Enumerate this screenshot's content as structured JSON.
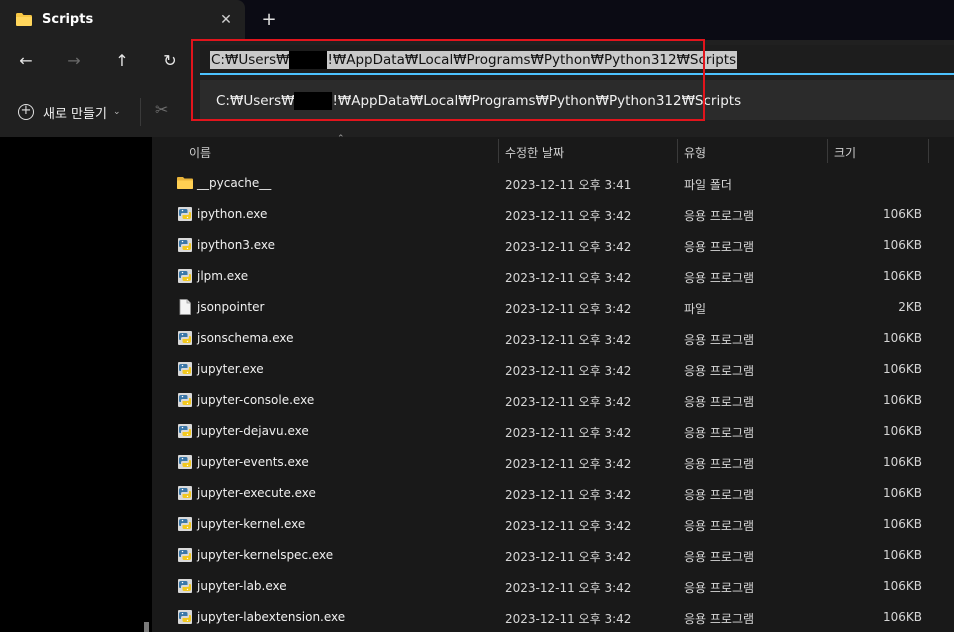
{
  "tab": {
    "title": "Scripts",
    "close_glyph": "✕",
    "new_tab_glyph": "+"
  },
  "nav": {
    "back_glyph": "←",
    "forward_glyph": "→",
    "up_glyph": "↑",
    "refresh_glyph": "↻"
  },
  "address": {
    "value_prefix": "C:₩Users₩",
    "value_suffix": "!₩AppData₩Local₩Programs₩Python₩Python312₩Scripts",
    "suggestion_prefix": "C:₩Users₩",
    "suggestion_suffix": "!₩AppData₩Local₩Programs₩Python₩Python312₩Scripts",
    "highlight_color": "#e2141c"
  },
  "command_bar": {
    "new_label": "새로 만들기",
    "new_icon": "plus-circle-icon",
    "chevron": "⌄",
    "cut_icon": "scissors-icon",
    "cut_glyph": "✂"
  },
  "columns": {
    "name": "이름",
    "date": "수정한 날짜",
    "type": "유형",
    "size": "크기",
    "sort_glyph": "⌃"
  },
  "files": [
    {
      "name": "__pycache__",
      "date": "2023-12-11 오후 3:41",
      "type": "파일 폴더",
      "size": "",
      "icon": "folder"
    },
    {
      "name": "ipython.exe",
      "date": "2023-12-11 오후 3:42",
      "type": "응용 프로그램",
      "size": "106KB",
      "icon": "python-exe"
    },
    {
      "name": "ipython3.exe",
      "date": "2023-12-11 오후 3:42",
      "type": "응용 프로그램",
      "size": "106KB",
      "icon": "python-exe"
    },
    {
      "name": "jlpm.exe",
      "date": "2023-12-11 오후 3:42",
      "type": "응용 프로그램",
      "size": "106KB",
      "icon": "python-exe"
    },
    {
      "name": "jsonpointer",
      "date": "2023-12-11 오후 3:42",
      "type": "파일",
      "size": "2KB",
      "icon": "file"
    },
    {
      "name": "jsonschema.exe",
      "date": "2023-12-11 오후 3:42",
      "type": "응용 프로그램",
      "size": "106KB",
      "icon": "python-exe"
    },
    {
      "name": "jupyter.exe",
      "date": "2023-12-11 오후 3:42",
      "type": "응용 프로그램",
      "size": "106KB",
      "icon": "python-exe"
    },
    {
      "name": "jupyter-console.exe",
      "date": "2023-12-11 오후 3:42",
      "type": "응용 프로그램",
      "size": "106KB",
      "icon": "python-exe"
    },
    {
      "name": "jupyter-dejavu.exe",
      "date": "2023-12-11 오후 3:42",
      "type": "응용 프로그램",
      "size": "106KB",
      "icon": "python-exe"
    },
    {
      "name": "jupyter-events.exe",
      "date": "2023-12-11 오후 3:42",
      "type": "응용 프로그램",
      "size": "106KB",
      "icon": "python-exe"
    },
    {
      "name": "jupyter-execute.exe",
      "date": "2023-12-11 오후 3:42",
      "type": "응용 프로그램",
      "size": "106KB",
      "icon": "python-exe"
    },
    {
      "name": "jupyter-kernel.exe",
      "date": "2023-12-11 오후 3:42",
      "type": "응용 프로그램",
      "size": "106KB",
      "icon": "python-exe"
    },
    {
      "name": "jupyter-kernelspec.exe",
      "date": "2023-12-11 오후 3:42",
      "type": "응용 프로그램",
      "size": "106KB",
      "icon": "python-exe"
    },
    {
      "name": "jupyter-lab.exe",
      "date": "2023-12-11 오후 3:42",
      "type": "응용 프로그램",
      "size": "106KB",
      "icon": "python-exe"
    },
    {
      "name": "jupyter-labextension.exe",
      "date": "2023-12-11 오후 3:42",
      "type": "응용 프로그램",
      "size": "106KB",
      "icon": "python-exe"
    }
  ]
}
